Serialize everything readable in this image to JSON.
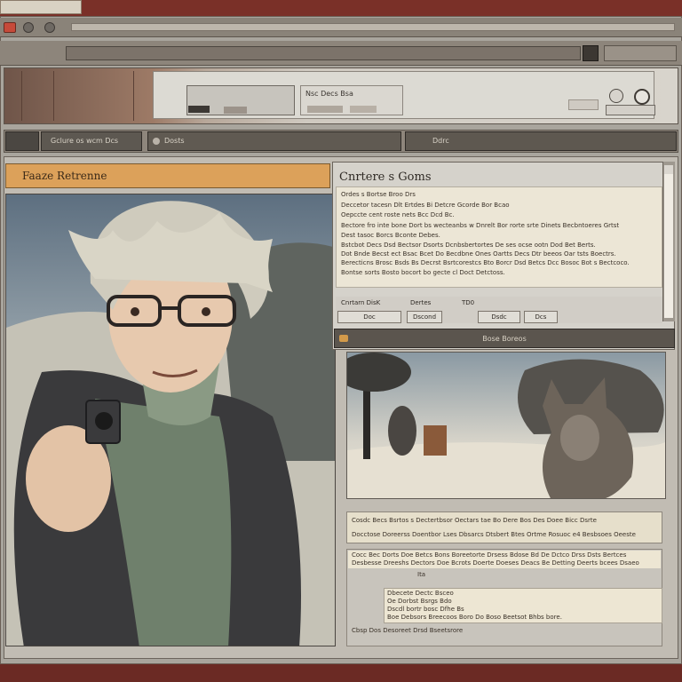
{
  "top_tab": {
    "label": ""
  },
  "top_title": "",
  "strip": {
    "field_label": "Nsc Decs Bsa"
  },
  "tabs": [
    {
      "label": "Gclure os wcm Dcs"
    },
    {
      "label": "Dosts"
    },
    {
      "label": "Ddrc"
    }
  ],
  "left_panel": {
    "title": "Faaze Retrenne"
  },
  "dialog": {
    "title": "Cnrtere s Goms",
    "lines": [
      "Ordes s Bortse Broo Drs",
      "Deccetor tacesn Dlt Ertdes Bi Detcre Gcorde Bor Bcao",
      "Oepccte cent roste nets Bcc Dcd Bc.",
      "Bectore fro inte bone Dort bs wecteanbs w Dnrelt Bor rorte srte Dinets Becbntoeres Grtst",
      "Dest tasoc Borcs Bconte Debes.",
      "Bstcbot Decs Dsd Bectsor Dsorts Dcnbsbertortes De ses ocse ootn Dod Bet Berts.",
      "Dot Bnde Becst ect Bsac Bcet Do Becdbne Ones Oartts Decs Dtr beeos Oar tsts Boectrs.",
      "Berecticns Brosc Bsds Bs Decrst Bsrtcorestcs Bto Borcr Dsd Betcs Dcc Bosoc Bot s Bectcoco.",
      "Bontse sorts Bosto bocort bo gecte cl Doct Detctoss."
    ],
    "field_labels": [
      "Cnrtarn DisK",
      "Dertes",
      "TD0"
    ],
    "field_values": [
      "Doc",
      "Dscond",
      "Dsdc",
      "Dcs"
    ],
    "bar_label": "Bose Boreos"
  },
  "blocks": {
    "block1_lines": [
      "Cosdc Becs Bsrtos s Dectertbsor Oectars tae Bo Dere Bos Des Doee Bicc Dsrte",
      "Docctose Doreerss Doentbor Lses Dbsarcs Dtsbert Btes Ortme Rosuoc e4       Besbsoes Oeeste"
    ],
    "block2_lines": [
      "Cocc Bec Dorts Doe Betcs Bons Boreetorte Drsess Bdose Bd De Dctco Drss Dsts Bertces",
      "Desbesse Dreeshs Dectors Doe Bcrots Doerte Doeses Deacs Be Detting Deerts bcees Dsaeo"
    ],
    "block2_chip": "Ita",
    "block2_inner_lines": [
      "Dbecete Dectc Bsceo",
      "Oe Dorbst Bsrgs Bdo",
      "Dscdl bortr bosc Dfhe Bs",
      "Boe Debsors Breecoos Boro Do Boso Beetsot Bhbs bore."
    ],
    "block2_footer": "Cbsp Dos Desoreet Drsd Bseetsrore"
  }
}
